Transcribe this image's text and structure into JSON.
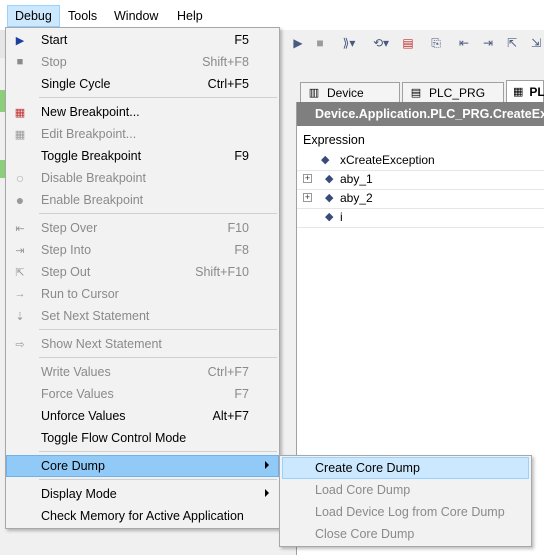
{
  "menubar": {
    "items": [
      {
        "label": "Debug"
      },
      {
        "label": "Tools"
      },
      {
        "label": "Window"
      },
      {
        "label": "Help"
      }
    ]
  },
  "tabs": [
    {
      "label": "Device"
    },
    {
      "label": "PLC_PRG"
    },
    {
      "label": "PLC"
    }
  ],
  "editor": {
    "path": "Device.Application.PLC_PRG.CreateExcep",
    "watch_header": "Expression",
    "rows": [
      {
        "name": "xCreateException",
        "expandable": false
      },
      {
        "name": "aby_1",
        "expandable": true
      },
      {
        "name": "aby_2",
        "expandable": true
      },
      {
        "name": "i",
        "expandable": false
      }
    ]
  },
  "debug_menu": {
    "start": {
      "label": "Start",
      "shortcut": "F5"
    },
    "stop": {
      "label": "Stop",
      "shortcut": "Shift+F8"
    },
    "single_cycle": {
      "label": "Single Cycle",
      "shortcut": "Ctrl+F5"
    },
    "new_breakpoint": {
      "label": "New Breakpoint..."
    },
    "edit_breakpoint": {
      "label": "Edit Breakpoint..."
    },
    "toggle_breakpoint": {
      "label": "Toggle Breakpoint",
      "shortcut": "F9"
    },
    "disable_breakpoint": {
      "label": "Disable Breakpoint"
    },
    "enable_breakpoint": {
      "label": "Enable Breakpoint"
    },
    "step_over": {
      "label": "Step Over",
      "shortcut": "F10"
    },
    "step_into": {
      "label": "Step Into",
      "shortcut": "F8"
    },
    "step_out": {
      "label": "Step Out",
      "shortcut": "Shift+F10"
    },
    "run_to_cursor": {
      "label": "Run to Cursor"
    },
    "set_next_statement": {
      "label": "Set Next Statement"
    },
    "show_next_statement": {
      "label": "Show Next Statement"
    },
    "write_values": {
      "label": "Write Values",
      "shortcut": "Ctrl+F7"
    },
    "force_values": {
      "label": "Force Values",
      "shortcut": "F7"
    },
    "unforce_values": {
      "label": "Unforce Values",
      "shortcut": "Alt+F7"
    },
    "toggle_flow_control": {
      "label": "Toggle Flow Control Mode"
    },
    "core_dump": {
      "label": "Core Dump"
    },
    "display_mode": {
      "label": "Display Mode"
    },
    "check_memory": {
      "label": "Check Memory for Active Application"
    }
  },
  "core_dump_submenu": {
    "create": {
      "label": "Create Core Dump"
    },
    "load": {
      "label": "Load Core Dump"
    },
    "load_device_log": {
      "label": "Load Device Log from Core Dump"
    },
    "close": {
      "label": "Close Core Dump"
    }
  },
  "colors": {
    "highlight": "#91c9f7",
    "submenu_highlight": "#cce8ff",
    "path_bar": "#7f7f7f",
    "disabled_text": "#8a8a8a"
  }
}
